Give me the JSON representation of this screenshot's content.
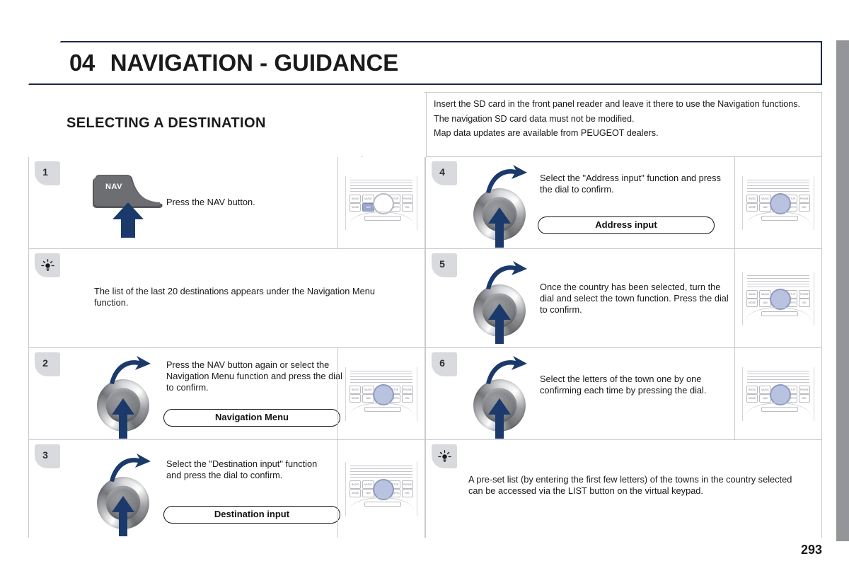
{
  "chapter": {
    "number": "04",
    "title": "NAVIGATION - GUIDANCE"
  },
  "section": {
    "title": "SELECTING A DESTINATION"
  },
  "intro": {
    "lines": [
      "Insert the SD card in the front panel reader and leave it there to use the Navigation functions.",
      "The navigation SD card data must not be modified.",
      "Map data updates are available from PEUGEOT dealers."
    ]
  },
  "left_column": [
    {
      "kind": "step",
      "number": "1",
      "text": "Press the NAV button.",
      "graphic": "nav-button",
      "nav_label": "NAV",
      "pill": null,
      "thumbnail": "facia-nav-highlighted"
    },
    {
      "kind": "tip",
      "icon": "light-bulb-icon",
      "text": "The list of the last 20 destinations appears under the Navigation Menu function."
    },
    {
      "kind": "step",
      "number": "2",
      "text": "Press the NAV button again or select the Navigation Menu function and press the dial to confirm.",
      "graphic": "dial",
      "pill": "Navigation Menu",
      "thumbnail": "facia-dial-highlighted"
    },
    {
      "kind": "step",
      "number": "3",
      "text": "Select the \"Destination input\" function and press the dial to confirm.",
      "graphic": "dial",
      "pill": "Destination input",
      "thumbnail": "facia-dial-highlighted"
    }
  ],
  "right_column": [
    {
      "kind": "step",
      "number": "4",
      "text": "Select the \"Address input\" function and press the dial to confirm.",
      "graphic": "dial",
      "pill": "Address input",
      "thumbnail": "facia-dial-highlighted"
    },
    {
      "kind": "step",
      "number": "5",
      "text": "Once the country has been selected, turn the dial and select the town function. Press the dial to confirm.",
      "graphic": "dial",
      "pill": null,
      "thumbnail": "facia-dial-highlighted"
    },
    {
      "kind": "step",
      "number": "6",
      "text": "Select the letters of the town one by one confirming each time by pressing the dial.",
      "graphic": "dial",
      "pill": null,
      "thumbnail": "facia-dial-highlighted"
    },
    {
      "kind": "tip",
      "icon": "light-bulb-icon",
      "text": "A pre-set list (by entering the first few letters) of the towns in the country selected can be accessed via the LIST button on the virtual keypad."
    }
  ],
  "facia": {
    "buttons_row1": [
      "RADIO",
      "MUSIC",
      "SETUP",
      "PHONE"
    ],
    "buttons_row2": [
      "MODE",
      "NAV",
      "TRAFFIC",
      "DEL"
    ]
  },
  "footer": {
    "page_number": "293"
  },
  "colors": {
    "header_border": "#1b2a4a",
    "arrow_navy": "#1b3a6b",
    "badge_grey": "#d9dadd",
    "facia_highlight": "#9aa6cc",
    "edge_tab": "#939598",
    "rule": "#c9cace"
  }
}
